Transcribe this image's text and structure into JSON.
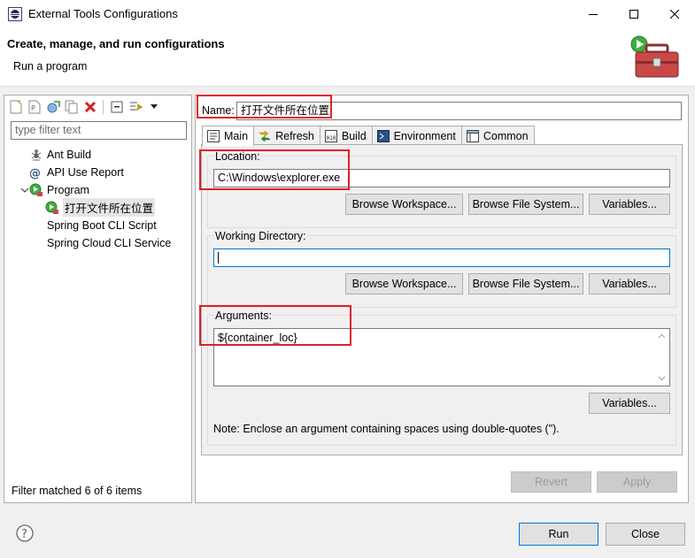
{
  "window": {
    "title": "External Tools Configurations",
    "controls": {
      "minimize": "minimize",
      "maximize": "maximize",
      "close": "close"
    }
  },
  "header": {
    "title": "Create, manage, and run configurations",
    "subtitle": "Run a program"
  },
  "left": {
    "filter_placeholder": "type filter text",
    "tree": [
      {
        "label": "Ant Build",
        "icon": "ant-icon"
      },
      {
        "label": "API Use Report",
        "icon": "api-report-icon"
      },
      {
        "label": "Program",
        "icon": "program-icon",
        "expanded": true
      },
      {
        "label": "打开文件所在位置",
        "icon": "program-run-icon",
        "selected": true
      },
      {
        "label": "Spring Boot CLI Script",
        "icon": "none"
      },
      {
        "label": "Spring Cloud CLI Service",
        "icon": "none"
      }
    ],
    "status": "Filter matched 6 of 6 items"
  },
  "right": {
    "name_label": "Name:",
    "name_value": "打开文件所在位置",
    "tabs": [
      {
        "label": "Main",
        "active": true
      },
      {
        "label": "Refresh"
      },
      {
        "label": "Build"
      },
      {
        "label": "Environment"
      },
      {
        "label": "Common"
      }
    ],
    "location": {
      "label": "Location:",
      "value": "C:\\Windows\\explorer.exe",
      "browse_workspace": "Browse Workspace...",
      "browse_fs": "Browse File System...",
      "variables": "Variables..."
    },
    "working_dir": {
      "label": "Working Directory:",
      "value": "",
      "browse_workspace": "Browse Workspace...",
      "browse_fs": "Browse File System...",
      "variables": "Variables..."
    },
    "arguments": {
      "label": "Arguments:",
      "value": "${container_loc}",
      "variables": "Variables...",
      "note": "Note: Enclose an argument containing spaces using double-quotes (\")."
    },
    "revert": "Revert",
    "apply": "Apply"
  },
  "footer": {
    "run": "Run",
    "close": "Close"
  },
  "colors": {
    "highlight": "#e0202a",
    "focus": "#0078d7"
  }
}
